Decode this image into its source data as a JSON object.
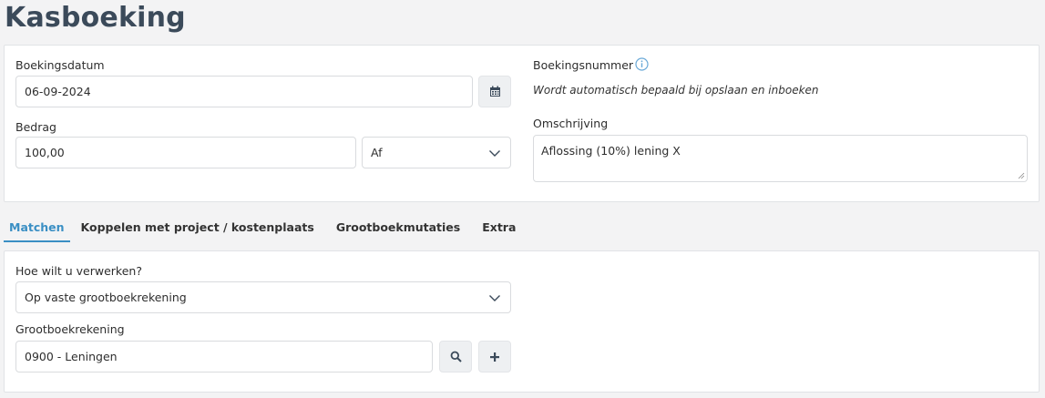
{
  "page": {
    "title": "Kasboeking"
  },
  "form": {
    "boekingsdatum": {
      "label": "Boekingsdatum",
      "value": "06-09-2024"
    },
    "bedrag": {
      "label": "Bedrag",
      "value": "100,00",
      "direction": "Af"
    },
    "boekingsnummer": {
      "label": "Boekingsnummer",
      "info": "Wordt automatisch bepaald bij opslaan en inboeken"
    },
    "omschrijving": {
      "label": "Omschrijving",
      "value": "Aflossing (10%) lening X"
    }
  },
  "tabs": [
    {
      "label": "Matchen",
      "active": true
    },
    {
      "label": "Koppelen met project / kostenplaats",
      "active": false
    },
    {
      "label": "Grootboekmutaties",
      "active": false
    },
    {
      "label": "Extra",
      "active": false
    }
  ],
  "matchen": {
    "verwerken": {
      "label": "Hoe wilt u verwerken?",
      "value": "Op vaste grootboekrekening"
    },
    "grootboekrekening": {
      "label": "Grootboekrekening",
      "value": "0900 - Leningen"
    }
  },
  "colors": {
    "accent": "#3a8fc4",
    "title": "#3b4a5a",
    "info_icon": "#6aa9d8"
  },
  "icons": [
    "calendar-icon",
    "info-icon",
    "chevron-down-icon",
    "search-icon",
    "plus-icon"
  ]
}
